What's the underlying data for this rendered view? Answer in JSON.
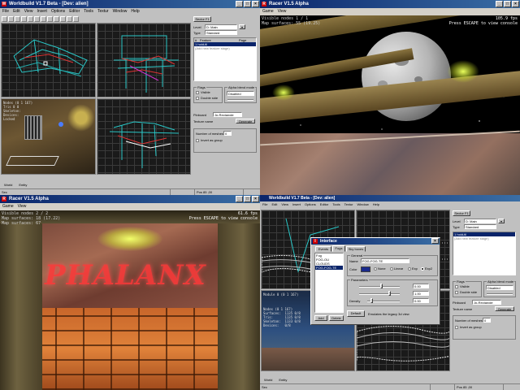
{
  "editor_top": {
    "title": "Worldbuild V1.7 Beta - [Dev: alien]",
    "menu": [
      "File",
      "Edit",
      "View",
      "Insert",
      "Options",
      "Editor",
      "Tools",
      "Textur",
      "Window",
      "Help"
    ],
    "viewport_label": "Module 0 (0 1 167)",
    "viewport_stats": "Nodes (0 1 167)\nTris 0 0\nSkeleton:\nDevices:\nLocked",
    "sector_button": "Sector F1",
    "level_label": "Level",
    "level_value": "D: Main",
    "type_label": "Type",
    "type_value": "Standard",
    "list_headers": [
      "#",
      "Feature",
      "Page"
    ],
    "list_rows": [
      {
        "num": "1",
        "feature": "hold-til",
        "page": ""
      },
      {
        "num": "",
        "feature": "(Add new feature stage)",
        "page": ""
      }
    ],
    "flags_title": "Flags",
    "flag_visible": "Visible",
    "flag_double": "Double side",
    "alpha_title": "Alpha blend mode",
    "alpha_value": "Disabled",
    "pinboard_label": "Pinboard",
    "pinboard_value": "Jp-Rectangle",
    "tex_label": "Texture name",
    "tex_button": "Generate",
    "num_label": "Number of meshes",
    "num_value": "0",
    "invert_label": "Invert as group",
    "tab_world": "World",
    "tab_entity": "Entity",
    "status": [
      "Sec",
      "",
      "Pos  85 ,00",
      ""
    ]
  },
  "racer_top": {
    "title": "Racer V1.5 Alpha",
    "menu": [
      "Game",
      "View"
    ],
    "hud_left": "Visible nodes 1 / 1\nMap surfaces: 55 (19.25)",
    "fps": "105.9 fps",
    "console_hint": "Press ESCAPE to view console"
  },
  "racer_bottom": {
    "title": "Racer V1.5 Alpha",
    "menu": [
      "Game",
      "View"
    ],
    "hud_left": "Visible nodes 2 / 2\nMap surfaces: 18 (17.22)\nMap surfaces: 67",
    "fps": "61.6 fps",
    "console_hint": "Press ESCAPE to view console",
    "wall_text": "PHALANX"
  },
  "editor_bottom": {
    "title": "Worldbuild V1.7 Beta - [Dev: alien]",
    "menu": [
      "File",
      "Edit",
      "View",
      "Insert",
      "Options",
      "Editor",
      "Tools",
      "Textur",
      "Window",
      "Help"
    ],
    "viewport_label": "Module 0 (0 1 167)",
    "viewport_stats": "Nodes (0 1 167)\nSurfaces:  1135 0/8\nTris:      1135 0/8\nSkeleton:  1133 0/8\nDevices:   0/8",
    "sector_button": "Sector F1",
    "level_label": "Level",
    "level_value": "D: Main",
    "type_label": "Type",
    "type_value": "Standard",
    "list_rows": [
      {
        "num": "1",
        "feature": "hold-til",
        "page": ""
      },
      {
        "num": "",
        "feature": "(Add new feature stage)",
        "page": ""
      }
    ],
    "flags_title": "Flags",
    "flag_visible": "Visible",
    "flag_double": "Double side",
    "alpha_title": "Alpha blend mode",
    "alpha_value": "Disabled",
    "pinboard_label": "Pinboard",
    "pinboard_value": "Jp-Rectangle",
    "tex_label": "Texture name",
    "tex_button": "Generate",
    "num_label": "Number of meshes",
    "num_value": "0",
    "invert_label": "Invert as group",
    "tab_world": "World",
    "tab_entity": "Entity",
    "status": [
      "Sec",
      "",
      "Pos  85 ,00",
      ""
    ],
    "dialog": {
      "title": "Interface",
      "tabs": [
        "Events",
        "Fogs",
        "Sky boxes"
      ],
      "list": [
        "Fog",
        "FOG-OU",
        "CLOUDS",
        "FOG-FOG-TE"
      ],
      "general_title": "General",
      "name_label": "Name",
      "name_value": "FOG-FOG-TE",
      "color_label": "Color",
      "mode_none": "None",
      "mode_linear": "Linear",
      "mode_exp": "Exp",
      "mode_exp2": "Exp2",
      "params_title": "Parameters",
      "density_label": "Density",
      "density_value": "0.00",
      "start_value": "0.00",
      "end_value": "1.00",
      "add_label": "Add",
      "delete_label": "Delete",
      "default_label": "Default",
      "note": "Emulates the legacy 3d view"
    }
  }
}
